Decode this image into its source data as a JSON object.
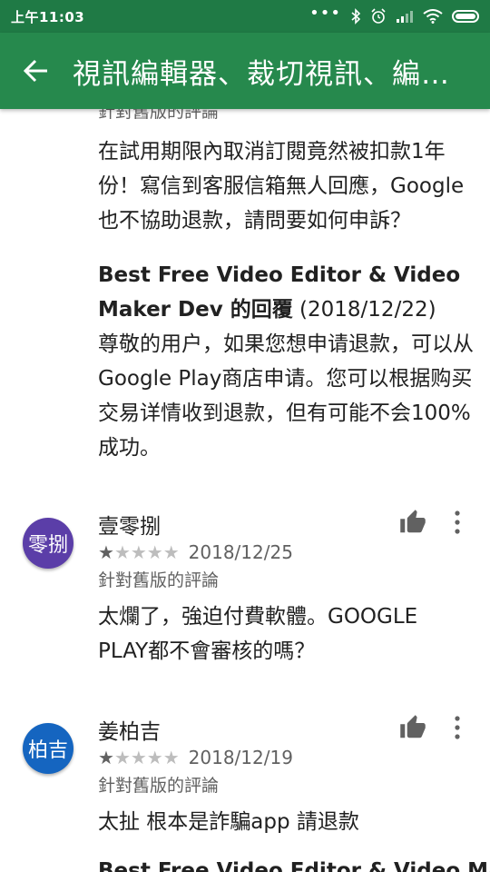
{
  "status_bar": {
    "time": "上午11:03"
  },
  "toolbar": {
    "title": "視訊編輯器、裁切視訊、編…"
  },
  "top_review": {
    "partial_label": "針對舊版的評論",
    "body": "在試用期限內取消訂閱竟然被扣款1年份！寫信到客服信箱無人回應，Google也不協助退款，請問要如何申訴？",
    "dev_reply": {
      "name": "Best Free Video Editor & Video Maker Dev 的回覆",
      "date": "(2018/12/22)",
      "body": "尊敬的用户，如果您想申请退款，可以从Google Play商店申请。您可以根据购买交易详情收到退款，但有可能不会100%成功。"
    }
  },
  "reviews": [
    {
      "avatar_text": "零捌",
      "avatar_color": "#5b3ea8",
      "name": "壹零捌",
      "rating": 1,
      "date": "2018/12/25",
      "version_label": "針對舊版的評論",
      "body": "太爛了，強迫付費軟體。GOOGLE PLAY都不會審核的嗎？"
    },
    {
      "avatar_text": "柏吉",
      "avatar_color": "#1565c0",
      "name": "姜柏吉",
      "rating": 1,
      "date": "2018/12/19",
      "version_label": "針對舊版的評論",
      "body": "太扯 根本是詐騙app 請退款"
    }
  ],
  "bottom_partial": "Best Free Video Editor & Video Maker",
  "colors": {
    "status_bar": "#1f7a45",
    "toolbar": "#26894d"
  }
}
